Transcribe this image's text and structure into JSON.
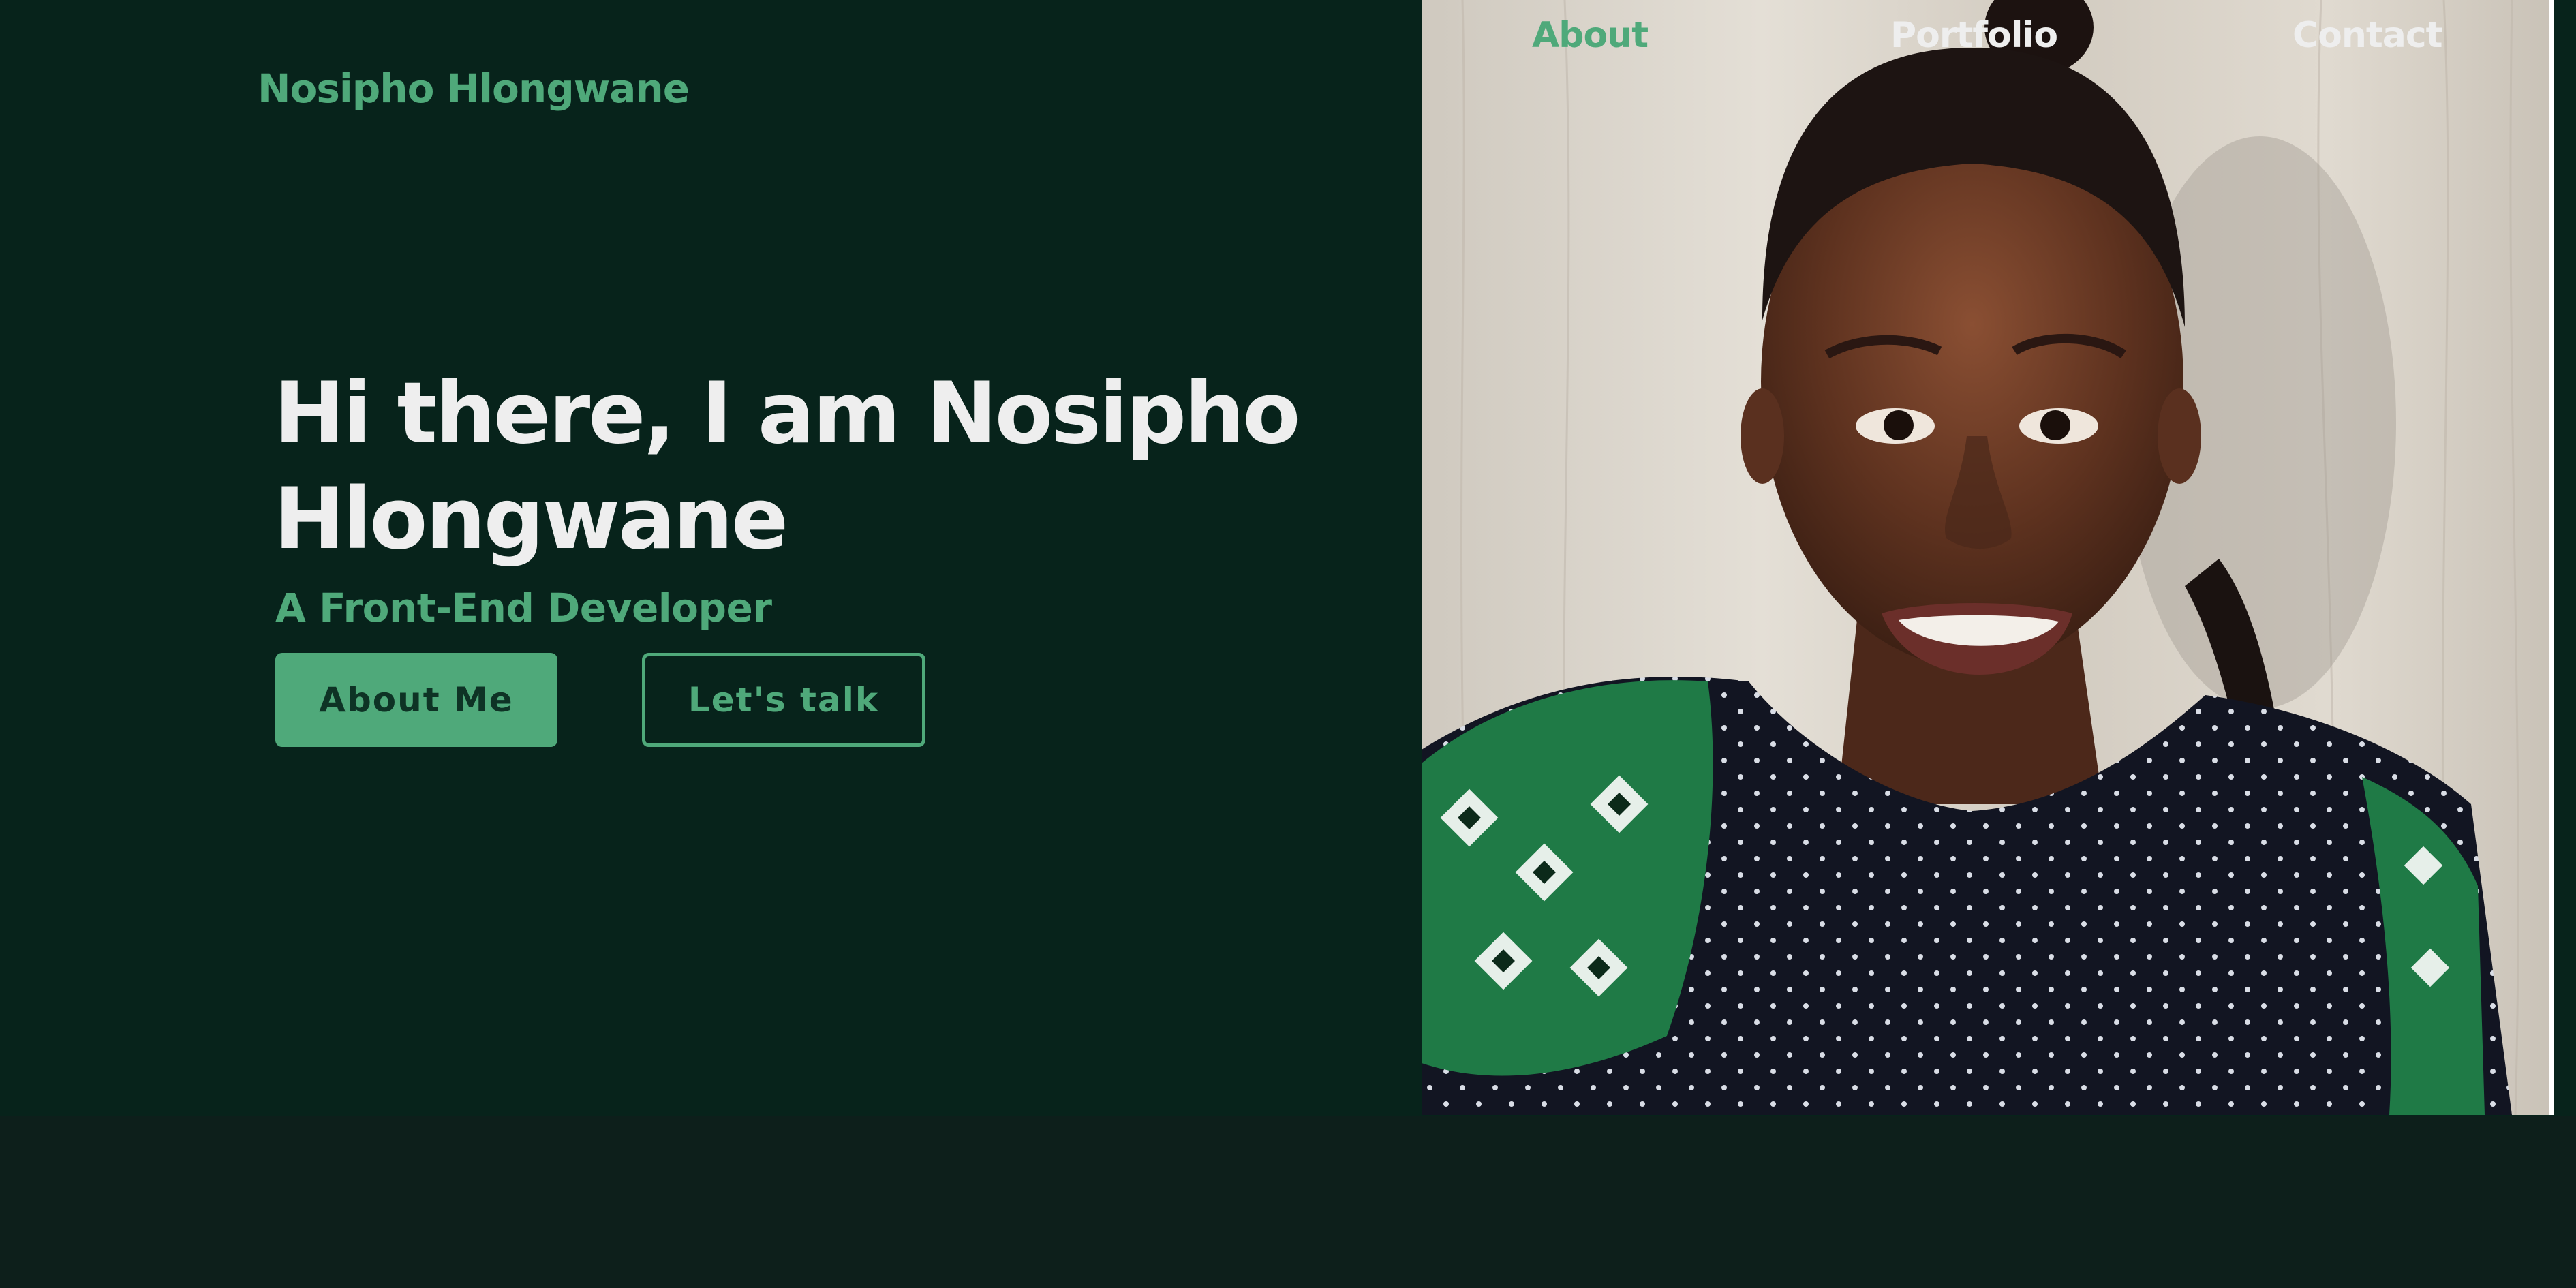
{
  "colors": {
    "accent": "#4fa97a",
    "hero_background": "#07231b",
    "page_background": "#0d1f1b",
    "text_light": "#eeeeee",
    "button_text_dark": "#0e3325"
  },
  "brand": {
    "logo_text": "Nosipho Hlongwane"
  },
  "nav": {
    "items": [
      {
        "label": "About",
        "active": true
      },
      {
        "label": "Portfolio",
        "active": false
      },
      {
        "label": "Contact",
        "active": false
      }
    ]
  },
  "hero": {
    "headline": "Hi there, I am Nosipho Hlongwane",
    "subtitle": "A Front-End Developer",
    "primary_button": "About Me",
    "secondary_button": "Let's talk"
  },
  "photo": {
    "subject": "portrait-photo"
  }
}
